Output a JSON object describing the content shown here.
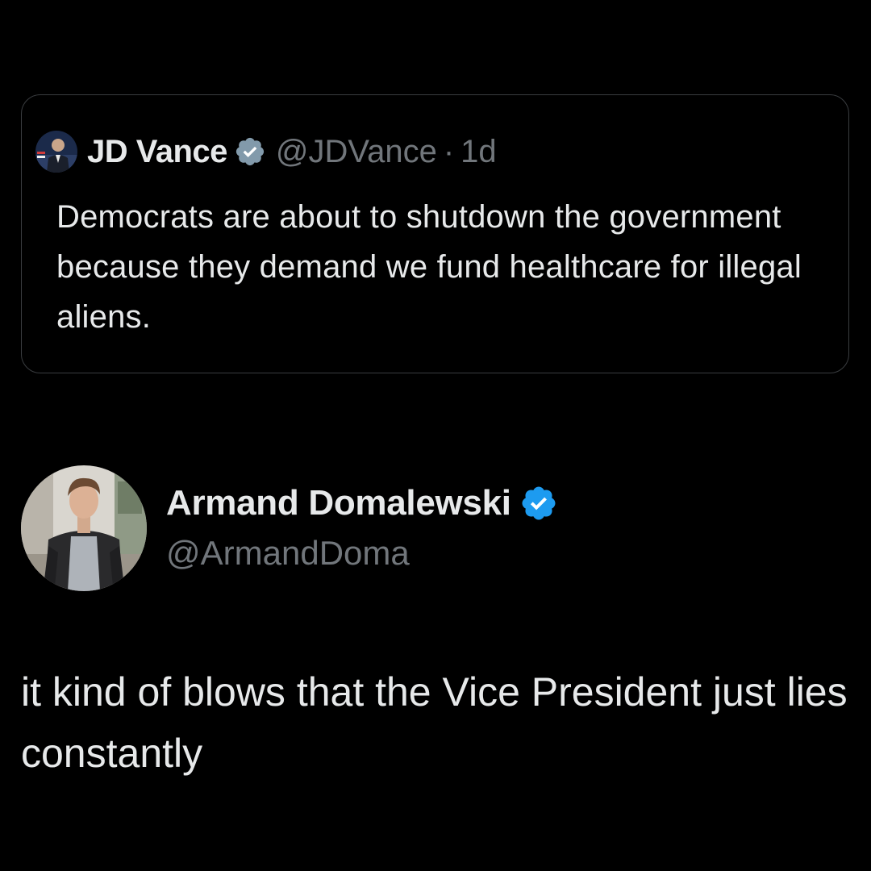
{
  "quoted_tweet": {
    "display_name": "JD Vance",
    "handle": "@JDVance",
    "separator": "·",
    "timestamp": "1d",
    "verified_icon": "verified-badge-gray-icon",
    "text": "Democrats are about to shutdown the government because they demand we fund healthcare for illegal aliens."
  },
  "tweet": {
    "display_name": "Armand Domalewski",
    "handle": "@ArmandDoma",
    "verified_icon": "verified-badge-blue-icon",
    "text": "it kind of blows that the Vice President just lies constantly"
  },
  "colors": {
    "background": "#000000",
    "primary_text": "#e7e9ea",
    "secondary_text": "#71767b",
    "card_border": "#3a3d40",
    "verified_blue": "#1d9bf0",
    "verified_gray": "#829aab"
  }
}
